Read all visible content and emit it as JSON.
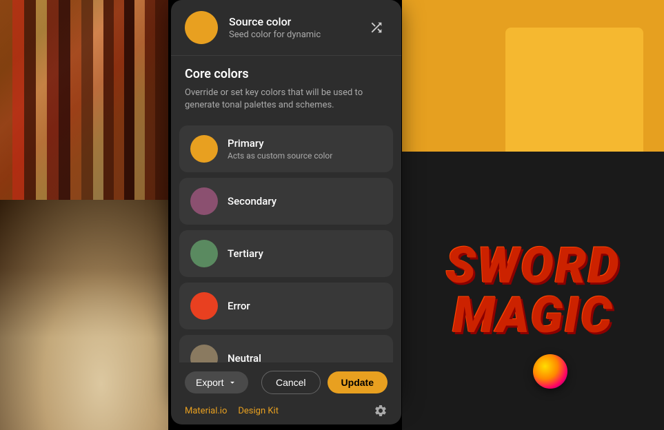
{
  "sourceColor": {
    "title": "Source color",
    "subtitle": "Seed color for dynamic",
    "color": "#e8a020"
  },
  "coreColors": {
    "title": "Core colors",
    "description": "Override or set key colors that will be used to generate tonal palettes and schemes.",
    "items": [
      {
        "id": "primary",
        "label": "Primary",
        "sublabel": "Acts as custom source color",
        "color": "#e8a020"
      },
      {
        "id": "secondary",
        "label": "Secondary",
        "sublabel": "",
        "color": "#8B5070"
      },
      {
        "id": "tertiary",
        "label": "Tertiary",
        "sublabel": "",
        "color": "#5a8a60"
      },
      {
        "id": "error",
        "label": "Error",
        "sublabel": "",
        "color": "#e84020"
      },
      {
        "id": "neutral",
        "label": "Neutral",
        "sublabel": "",
        "color": "#8a7a60"
      }
    ]
  },
  "toolbar": {
    "export_label": "Export",
    "cancel_label": "Cancel",
    "update_label": "Update"
  },
  "footer": {
    "material_link": "Material.io",
    "design_kit_link": "Design Kit"
  },
  "background_text": {
    "sword": "SWORD",
    "magic": "MAG"
  }
}
